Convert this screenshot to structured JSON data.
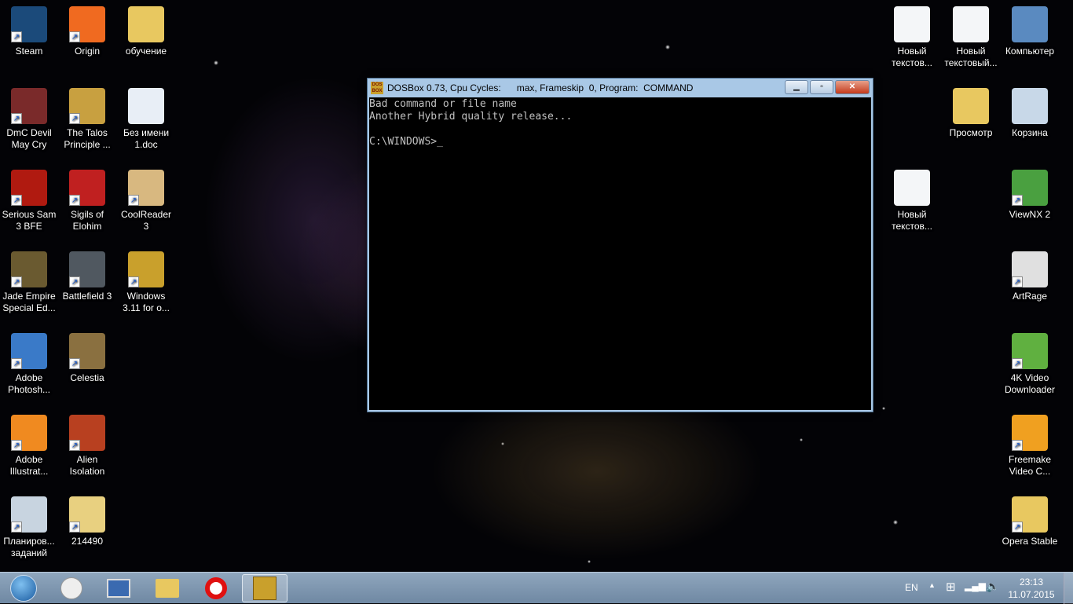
{
  "desktop": {
    "left": [
      [
        {
          "label": "Steam",
          "color": "#1b4a7a"
        },
        {
          "label": "DmC Devil May Cry",
          "color": "#7a2a2a"
        },
        {
          "label": "Serious Sam 3 BFE",
          "color": "#b01a10"
        },
        {
          "label": "Jade Empire Special Ed...",
          "color": "#6a5a30"
        },
        {
          "label": "Adobe Photosh...",
          "color": "#3a7ac8"
        },
        {
          "label": "Adobe Illustrat...",
          "color": "#f08a20"
        },
        {
          "label": "Планиров... заданий",
          "color": "#c8d4e0"
        }
      ],
      [
        {
          "label": "Origin",
          "color": "#f06a20"
        },
        {
          "label": "The Talos Principle ...",
          "color": "#c8a040"
        },
        {
          "label": "Sigils of Elohim",
          "color": "#c02020"
        },
        {
          "label": "Battlefield 3",
          "color": "#505860"
        },
        {
          "label": "Celestia",
          "color": "#8a7040"
        },
        {
          "label": "Alien Isolation",
          "color": "#b84020"
        },
        {
          "label": "214490",
          "color": "#e8d080"
        }
      ],
      [
        {
          "label": "обучение",
          "color": "#e8c860"
        },
        {
          "label": "Без имени 1.doc",
          "color": "#e8eef6"
        },
        {
          "label": "CoolReader 3",
          "color": "#d8b880"
        },
        {
          "label": "Windows 3.11 for o...",
          "color": "#c9a02c"
        }
      ]
    ],
    "right": {
      "col1": [
        {
          "label": "Новый текстов...",
          "row": 0
        },
        {
          "label": "Новый текстов...",
          "row": 2
        }
      ],
      "col2": [
        {
          "label": "Новый текстовый...",
          "row": 0
        },
        {
          "label": "Просмотр",
          "row": 1
        }
      ],
      "col3": [
        {
          "label": "Компьютер"
        },
        {
          "label": "Корзина"
        },
        {
          "label": "ViewNX 2"
        },
        {
          "label": "ArtRage"
        },
        {
          "label": "4K Video Downloader"
        },
        {
          "label": "Freemake Video C..."
        },
        {
          "label": "Opera Stable"
        }
      ]
    }
  },
  "dosbox": {
    "title": "DOSBox 0.73, Cpu Cycles:      max, Frameskip  0, Program:  COMMAND",
    "icon_text": "DOS BOX",
    "lines": [
      "Bad command or file name",
      "Another Hybrid quality release...",
      "",
      "C:\\WINDOWS>_"
    ]
  },
  "taskbar": {
    "lang": "EN",
    "time": "23:13",
    "date": "11.07.2015"
  }
}
